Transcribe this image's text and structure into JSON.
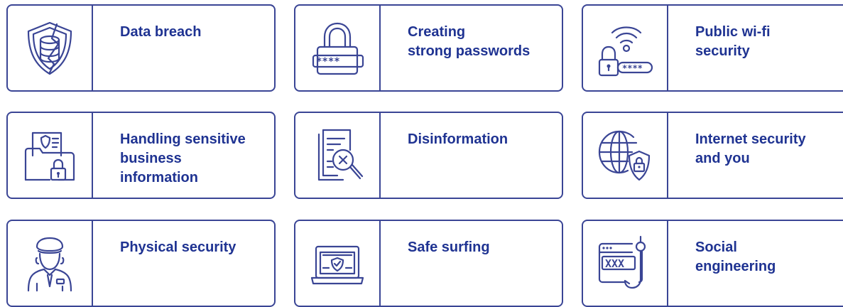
{
  "colors": {
    "border": "#3A4595",
    "title": "#1F3392"
  },
  "cards": [
    {
      "icon": "shield-database-icon",
      "lines": [
        "Data breach"
      ]
    },
    {
      "icon": "padlock-password-icon",
      "lines": [
        "Creating",
        "strong passwords"
      ],
      "icon_text": "****_"
    },
    {
      "icon": "wifi-lock-icon",
      "lines": [
        "Public wi-fi",
        "security"
      ],
      "icon_text": "****"
    },
    {
      "icon": "secure-folder-icon",
      "lines": [
        "Handling sensitive",
        "business",
        "information"
      ]
    },
    {
      "icon": "document-magnifier-icon",
      "lines": [
        "Disinformation"
      ]
    },
    {
      "icon": "globe-shield-icon",
      "lines": [
        "Internet security",
        "and you"
      ]
    },
    {
      "icon": "security-guard-icon",
      "lines": [
        "Physical security"
      ]
    },
    {
      "icon": "laptop-shield-icon",
      "lines": [
        "Safe surfing"
      ]
    },
    {
      "icon": "browser-hook-icon",
      "lines": [
        "Social",
        "engineering"
      ],
      "icon_text": "XXX"
    }
  ]
}
